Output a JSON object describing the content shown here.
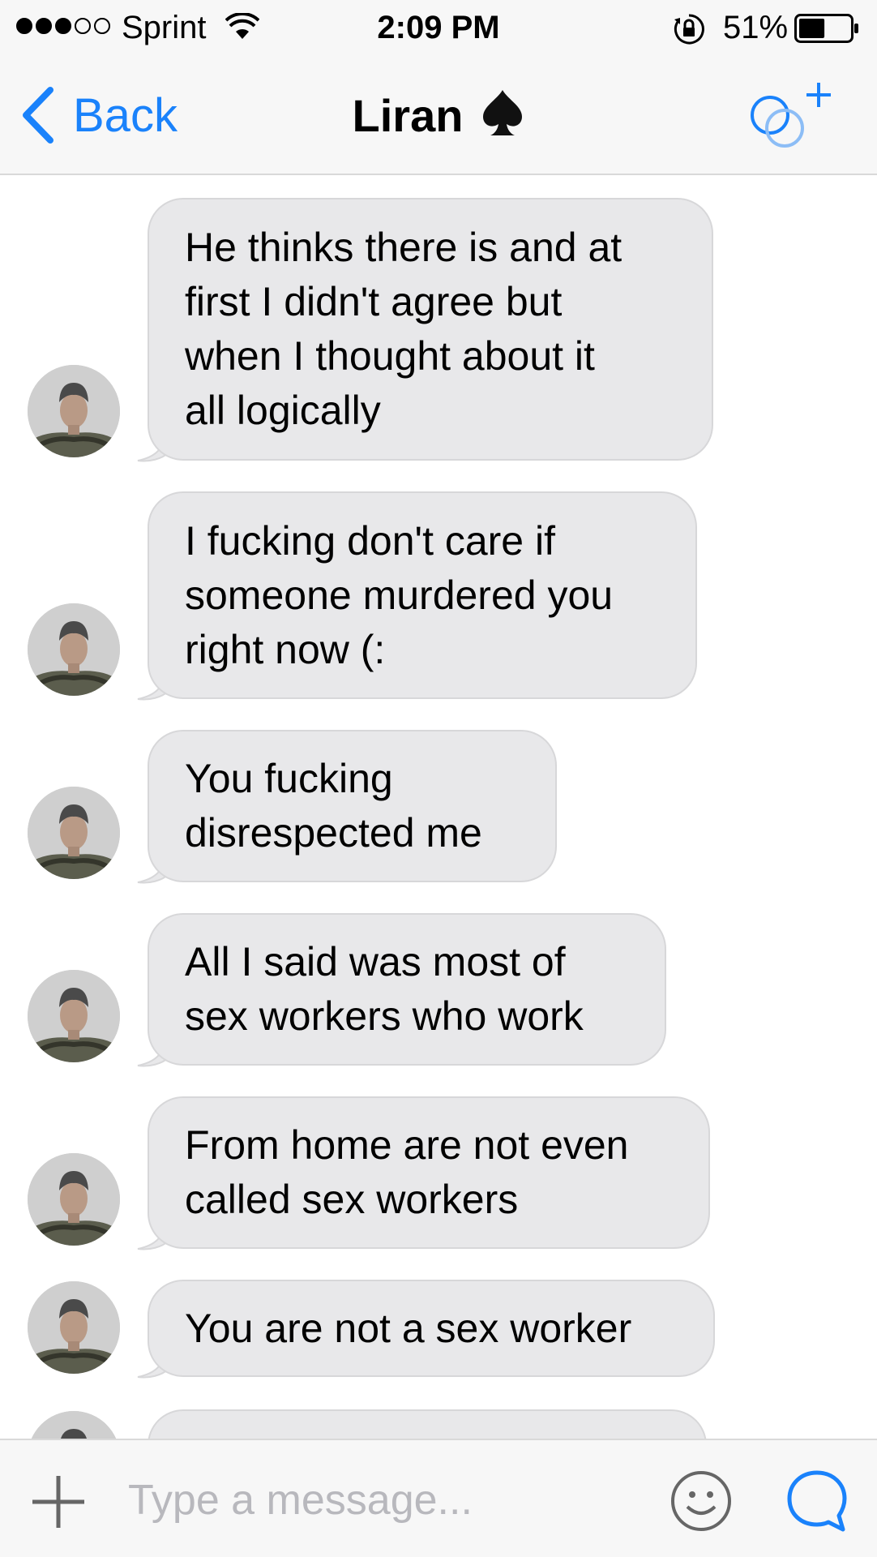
{
  "status_bar": {
    "signal_bars_filled": 3,
    "signal_bars_total": 5,
    "carrier": "Sprint",
    "time": "2:09 PM",
    "battery_percent": "51%",
    "battery_level": 0.51,
    "icons": [
      "wifi-icon",
      "rotation-lock-icon",
      "battery-icon"
    ]
  },
  "nav": {
    "back_label": "Back",
    "title": "Liran",
    "title_icon": "spade-icon",
    "add_people_icon": "add-people-icon"
  },
  "messages": [
    {
      "text": "He thinks there is and at\nfirst I didn't agree but\nwhen I thought about it\nall logically",
      "incoming": true
    },
    {
      "text": "I fucking don't care if\nsomeone murdered you\nright now (:",
      "incoming": true
    },
    {
      "text": "You fucking\ndisrespected me",
      "incoming": true
    },
    {
      "text": "All I said was most of\nsex workers who work",
      "incoming": true
    },
    {
      "text": "From home are not even\ncalled sex workers",
      "incoming": true
    },
    {
      "text": "You are not a sex worker",
      "incoming": true
    },
    {
      "text": "",
      "incoming": true,
      "partially_visible": true
    }
  ],
  "composer": {
    "placeholder": "Type a message...",
    "value": "",
    "icons": [
      "plus-icon",
      "emoji-icon",
      "chat-bubble-icon"
    ]
  },
  "colors": {
    "accent": "#1a82fb",
    "bubble_incoming": "#e8e8ea",
    "bar_background": "#f7f7f7"
  }
}
